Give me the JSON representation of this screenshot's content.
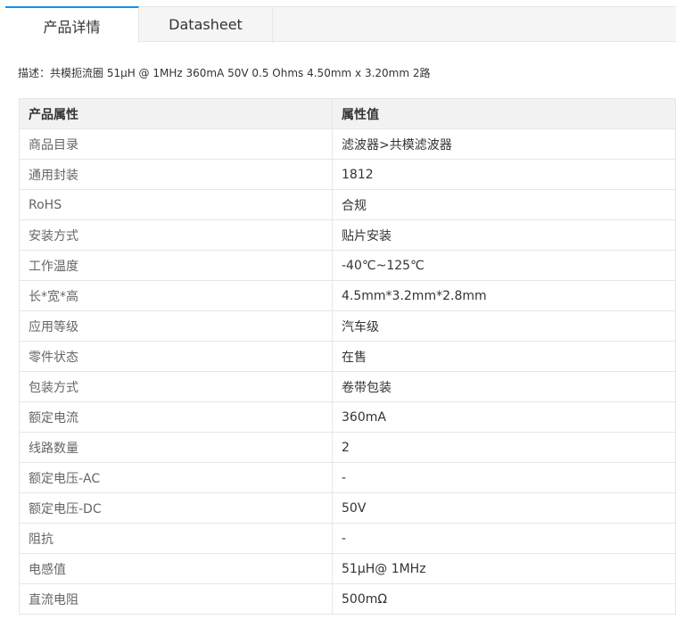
{
  "tabs": [
    {
      "label": "产品详情",
      "active": true
    },
    {
      "label": "Datasheet",
      "active": false
    }
  ],
  "description": "描述：共模扼流圈 51μH @ 1MHz 360mA 50V 0.5 Ohms 4.50mm x 3.20mm 2路",
  "table": {
    "headers": [
      "产品属性",
      "属性值"
    ],
    "rows": [
      {
        "name": "商品目录",
        "value": "滤波器>共模滤波器"
      },
      {
        "name": "通用封装",
        "value": "1812"
      },
      {
        "name": "RoHS",
        "value": "合规"
      },
      {
        "name": "安装方式",
        "value": "贴片安装"
      },
      {
        "name": "工作温度",
        "value": "-40℃~125℃"
      },
      {
        "name": "长*宽*高",
        "value": "4.5mm*3.2mm*2.8mm"
      },
      {
        "name": "应用等级",
        "value": "汽车级"
      },
      {
        "name": "零件状态",
        "value": "在售"
      },
      {
        "name": "包装方式",
        "value": "卷带包装"
      },
      {
        "name": "额定电流",
        "value": "360mA"
      },
      {
        "name": "线路数量",
        "value": "2"
      },
      {
        "name": "额定电压-AC",
        "value": "-"
      },
      {
        "name": "额定电压-DC",
        "value": "50V"
      },
      {
        "name": "阻抗",
        "value": "-"
      },
      {
        "name": "电感值",
        "value": "51μH@ 1MHz"
      },
      {
        "name": "直流电阻",
        "value": "500mΩ"
      }
    ]
  },
  "colors": {
    "accent": "#1e8fe1",
    "header_bg": "#f2f2f2",
    "border": "#e6e6e6"
  }
}
